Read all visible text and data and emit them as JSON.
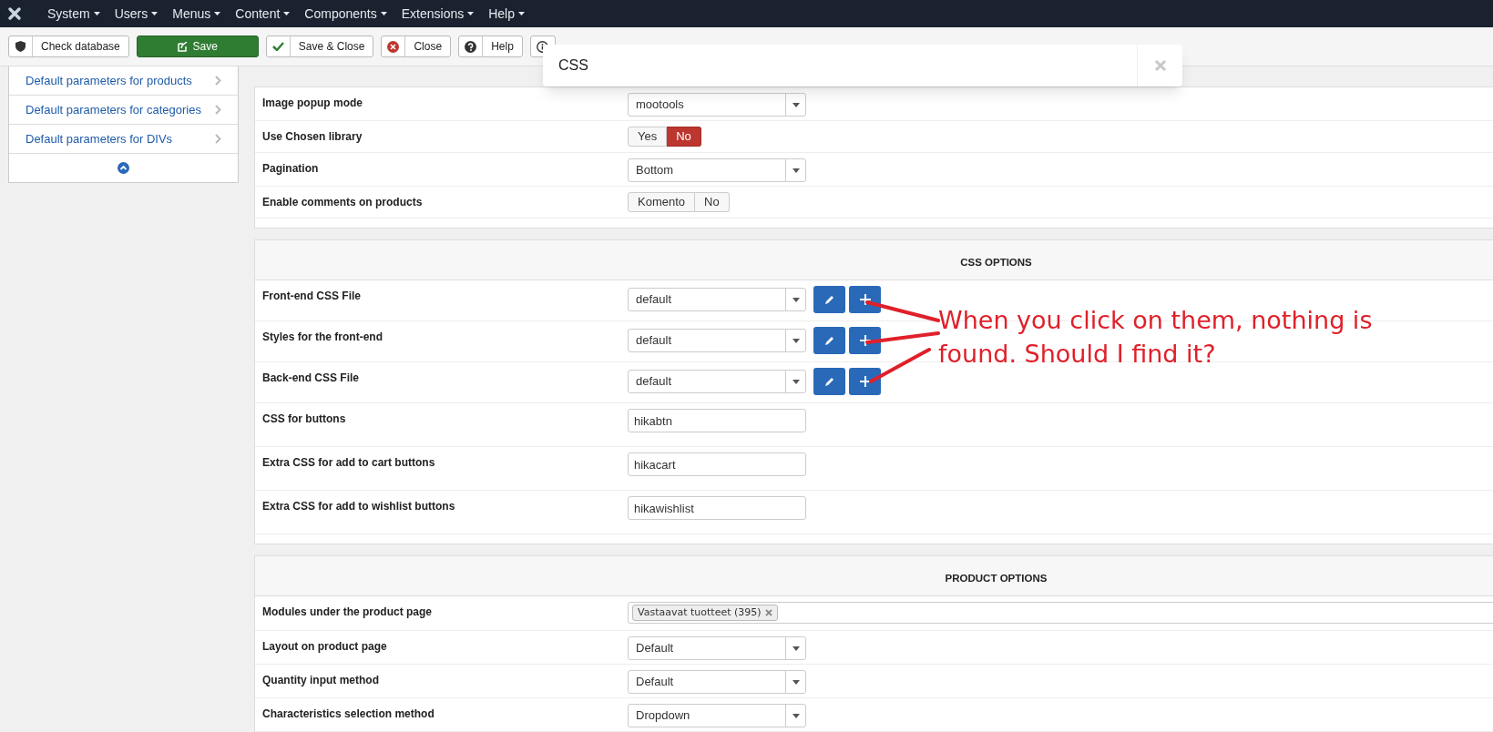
{
  "navbar": {
    "menus": [
      "System",
      "Users",
      "Menus",
      "Content",
      "Components",
      "Extensions",
      "Help"
    ]
  },
  "toolbar": {
    "buttons": [
      {
        "kind": "shield",
        "label": "Check database"
      },
      {
        "kind": "save",
        "label": "Save"
      },
      {
        "kind": "check",
        "label": "Save & Close"
      },
      {
        "kind": "close",
        "label": "Close"
      },
      {
        "kind": "help",
        "label": "Help"
      },
      {
        "kind": "info"
      }
    ]
  },
  "sidebar": {
    "items": [
      "Default parameters for products",
      "Default parameters for categories",
      "Default parameters for DIVs"
    ]
  },
  "sections": [
    {
      "rows": [
        {
          "kind": "select",
          "label": "Image popup mode",
          "value": "mootools"
        },
        {
          "kind": "toggle",
          "label": "Use Chosen library",
          "options": [
            {
              "label": "Yes",
              "selected": false
            },
            {
              "label": "No",
              "selected": true
            }
          ]
        },
        {
          "kind": "select",
          "label": "Pagination",
          "value": "Bottom"
        },
        {
          "kind": "toggle",
          "label": "Enable comments on products",
          "options": [
            {
              "label": "Komento",
              "selected": false
            },
            {
              "label": "No",
              "selected": false
            }
          ]
        }
      ]
    },
    {
      "title": "CSS OPTIONS",
      "rows": [
        {
          "kind": "select_actions",
          "label": "Front-end CSS File",
          "value": "default"
        },
        {
          "kind": "select_actions",
          "label": "Styles for the front-end",
          "value": "default"
        },
        {
          "kind": "select_actions",
          "label": "Back-end CSS File",
          "value": "default"
        },
        {
          "kind": "text",
          "label": "CSS for buttons",
          "value": "hikabtn"
        },
        {
          "kind": "text",
          "label": "Extra CSS for add to cart buttons",
          "value": "hikacart"
        },
        {
          "kind": "text",
          "label": "Extra CSS for add to wishlist buttons",
          "value": "hikawishlist"
        }
      ]
    },
    {
      "title": "PRODUCT OPTIONS",
      "rows": [
        {
          "kind": "tags",
          "label": "Modules under the product page",
          "tags": [
            "Vastaavat tuotteet (395)"
          ]
        },
        {
          "kind": "select",
          "label": "Layout on product page",
          "value": "Default"
        },
        {
          "kind": "select",
          "label": "Quantity input method",
          "value": "Default"
        },
        {
          "kind": "select",
          "label": "Characteristics selection method",
          "value": "Dropdown"
        }
      ]
    }
  ],
  "annotation": {
    "text": "When you click on them, nothing is found. Should I find it?"
  },
  "modal": {
    "value": "CSS"
  }
}
